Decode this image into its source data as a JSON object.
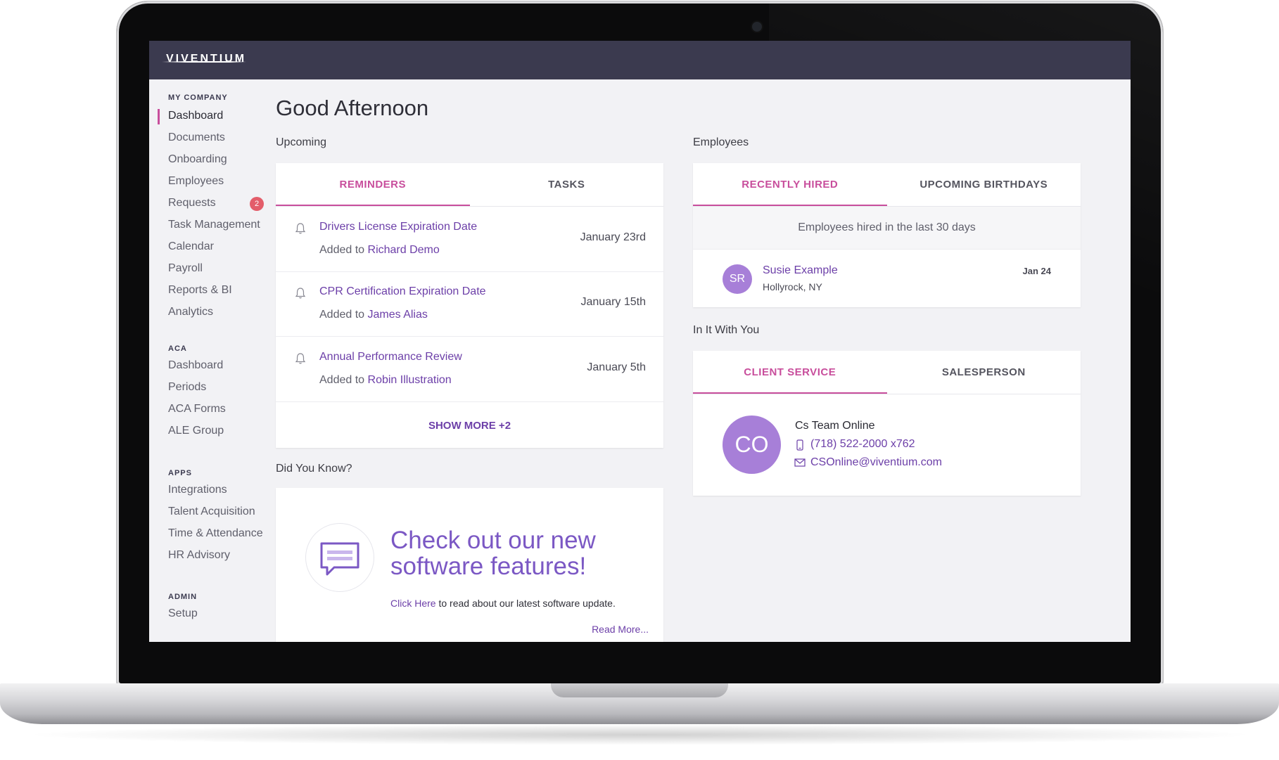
{
  "brand": {
    "logo": "VIVENTIUM"
  },
  "sidebar": {
    "sections": [
      {
        "title": "MY COMPANY",
        "items": [
          "Dashboard",
          "Documents",
          "Onboarding",
          "Employees",
          "Requests",
          "Task Management",
          "Calendar",
          "Payroll",
          "Reports & BI",
          "Analytics"
        ]
      },
      {
        "title": "ACA",
        "items": [
          "Dashboard",
          "Periods",
          "ACA Forms",
          "ALE Group"
        ]
      },
      {
        "title": "APPS",
        "items": [
          "Integrations",
          "Talent Acquisition",
          "Time & Attendance",
          "HR Advisory"
        ]
      },
      {
        "title": "ADMIN",
        "items": [
          "Setup"
        ]
      }
    ],
    "active_item": "Dashboard",
    "requests_badge": "2"
  },
  "main": {
    "greeting": "Good Afternoon",
    "upcoming": {
      "label": "Upcoming",
      "tabs": [
        "REMINDERS",
        "TASKS"
      ],
      "active_tab": "REMINDERS",
      "reminders": [
        {
          "title": "Drivers License Expiration Date",
          "added_prefix": "Added to",
          "person": "Richard Demo",
          "date": "January 23rd"
        },
        {
          "title": "CPR Certification Expiration Date",
          "added_prefix": "Added to",
          "person": "James Alias",
          "date": "January 15th"
        },
        {
          "title": "Annual Performance Review",
          "added_prefix": "Added to",
          "person": "Robin Illustration",
          "date": "January 5th"
        }
      ],
      "show_more": "SHOW MORE +2"
    },
    "did_you_know": {
      "label": "Did You Know?",
      "headline_line1": "Check out our new",
      "headline_line2": "software features!",
      "click_here": "Click Here",
      "body": "to read about our latest software update.",
      "read_more": "Read More...",
      "icon": "chat-bubble-icon"
    },
    "employees": {
      "label": "Employees",
      "tabs": [
        "RECENTLY HIRED",
        "UPCOMING BIRTHDAYS"
      ],
      "active_tab": "RECENTLY HIRED",
      "subtitle": "Employees hired in the last 30 days",
      "hires": [
        {
          "initials": "SR",
          "name": "Susie Example",
          "location": "Hollyrock, NY",
          "date": "Jan 24"
        }
      ]
    },
    "in_it_with_you": {
      "label": "In It With You",
      "tabs": [
        "CLIENT SERVICE",
        "SALESPERSON"
      ],
      "active_tab": "CLIENT SERVICE",
      "contact": {
        "initials": "CO",
        "name": "Cs Team Online",
        "phone": "(718) 522-2000 x762",
        "email": "CSOnline@viventium.com"
      }
    }
  },
  "colors": {
    "accent_pink": "#c84e9c",
    "accent_purple": "#6c3fa8",
    "topbar": "#3b3a4f",
    "avatar": "#a77fd8"
  }
}
